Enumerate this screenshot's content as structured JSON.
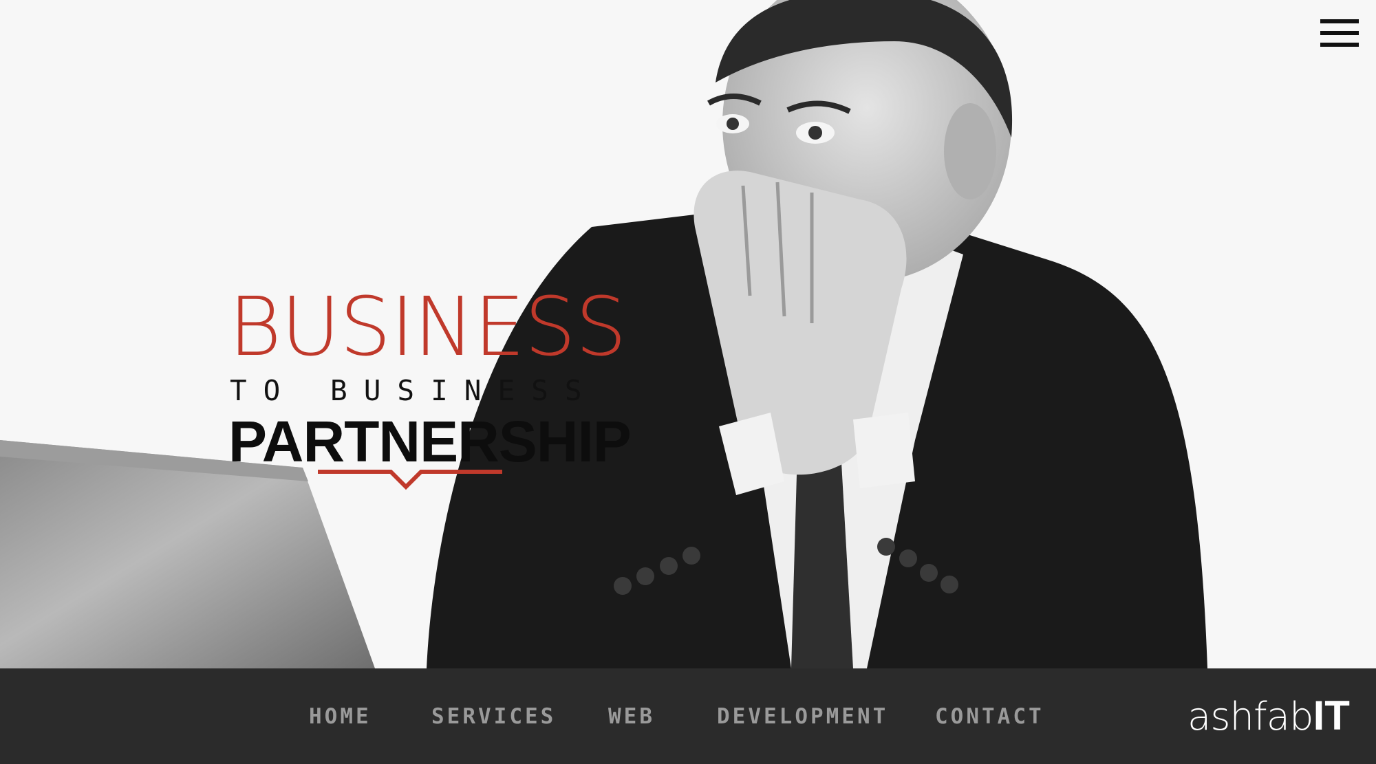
{
  "hero": {
    "image": "businessman-covering-mouth-in-shock-at-laptop",
    "headline": {
      "top": "BUSINESS",
      "middle": "TO BUSINESS",
      "bottom": "PARTNERSHIP"
    },
    "accent_color": "#c0392b"
  },
  "menu": {
    "icon": "hamburger-menu-icon"
  },
  "footer": {
    "background": "#2b2b2b",
    "nav": [
      {
        "label": "HOME"
      },
      {
        "label": "SERVICES"
      },
      {
        "label": "WEB"
      },
      {
        "label": "DEVELOPMENT"
      },
      {
        "label": "CONTACT"
      }
    ],
    "brand": {
      "light": "ashfab",
      "bold": "IT"
    }
  }
}
